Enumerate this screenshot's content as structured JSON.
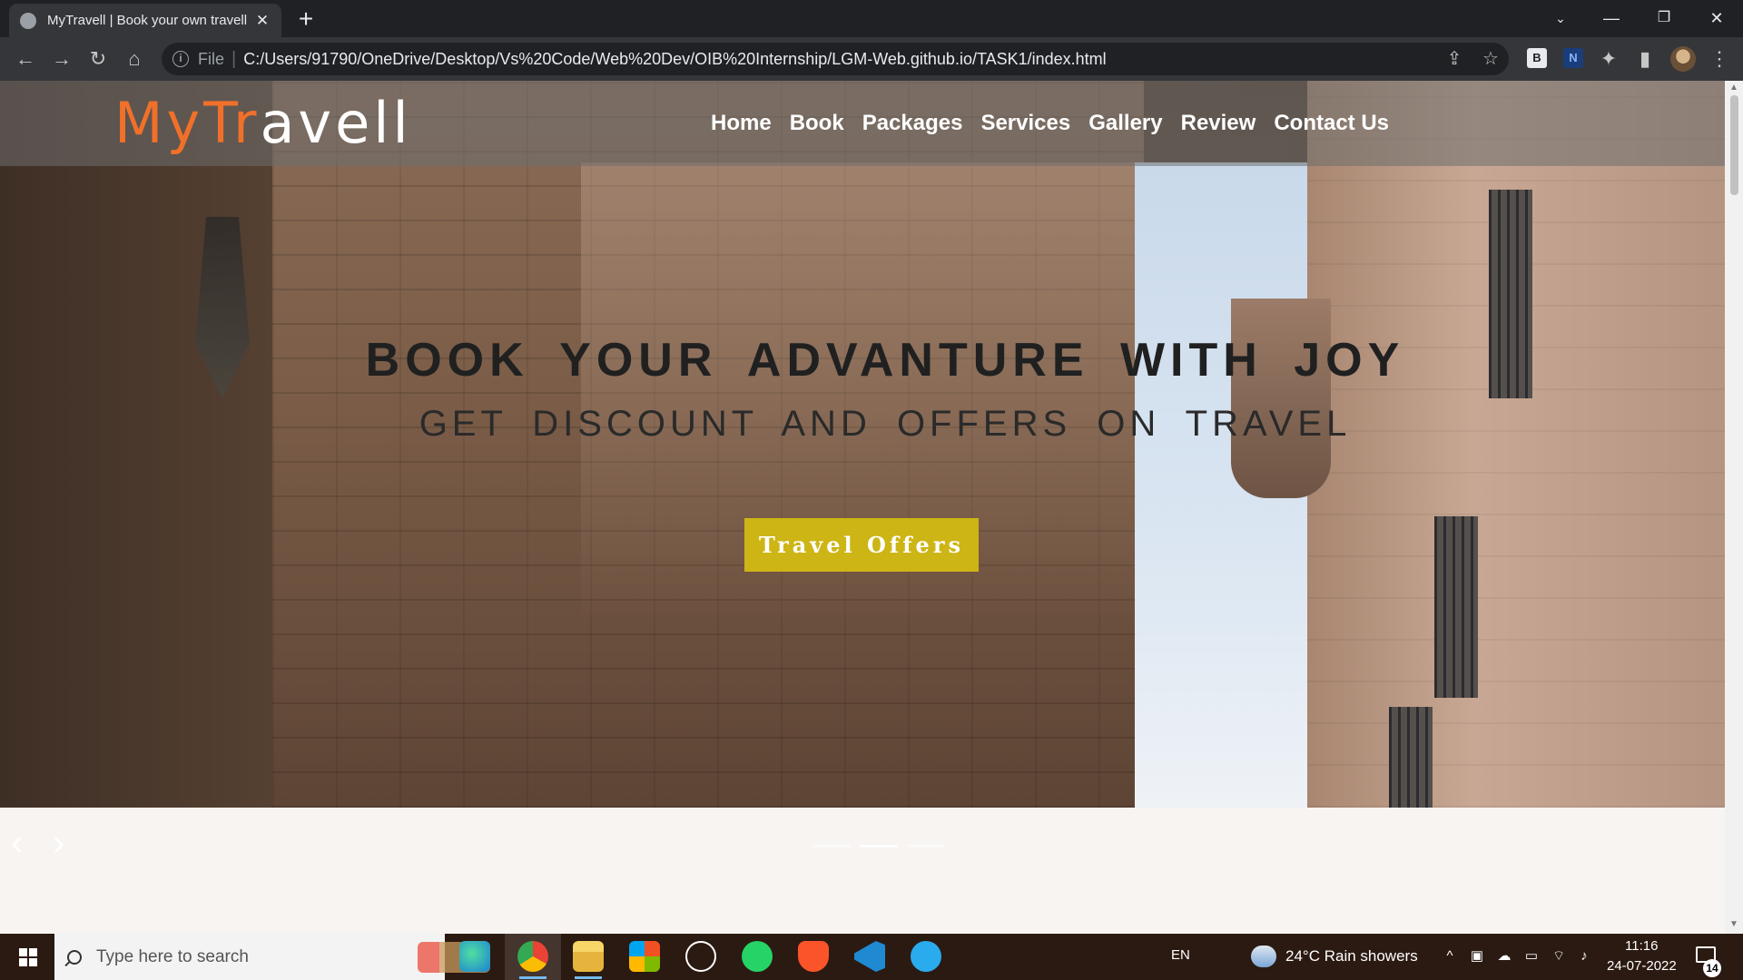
{
  "browser": {
    "tab_title": "MyTravell | Book your own travell",
    "new_tab_icon": "plus-icon",
    "address": {
      "scheme_label": "File",
      "url": "C:/Users/91790/OneDrive/Desktop/Vs%20Code/Web%20Dev/OIB%20Internship/LGM-Web.github.io/TASK1/index.html"
    },
    "extensions": [
      "B",
      "N"
    ]
  },
  "site": {
    "logo_part_colored": "MyTr",
    "logo_part_white": "avell",
    "logo_color": "#f0702a",
    "nav": [
      "Home",
      "Book",
      "Packages",
      "Services",
      "Gallery",
      "Review",
      "Contact Us"
    ],
    "hero": {
      "headline": "BOOK YOUR ADVANTURE WITH JOY",
      "subline": "GET DISCOUNT AND OFFERS ON TRAVEL",
      "cta_label": "Travel Offers",
      "cta_color": "#cdb515"
    },
    "carousel": {
      "prev_glyph": "‹",
      "next_glyph": "›",
      "slide_count": 3,
      "active_index": 1
    }
  },
  "taskbar": {
    "search_placeholder": "Type here to search",
    "language": "EN",
    "weather": "24°C  Rain showers",
    "time": "11:16",
    "date": "24-07-2022",
    "notification_count": "14",
    "apps": [
      "edge-icon",
      "chrome-icon",
      "file-explorer-icon",
      "store-icon",
      "dell-icon",
      "whatsapp-icon",
      "brave-icon",
      "vscode-icon",
      "telegram-icon"
    ]
  }
}
